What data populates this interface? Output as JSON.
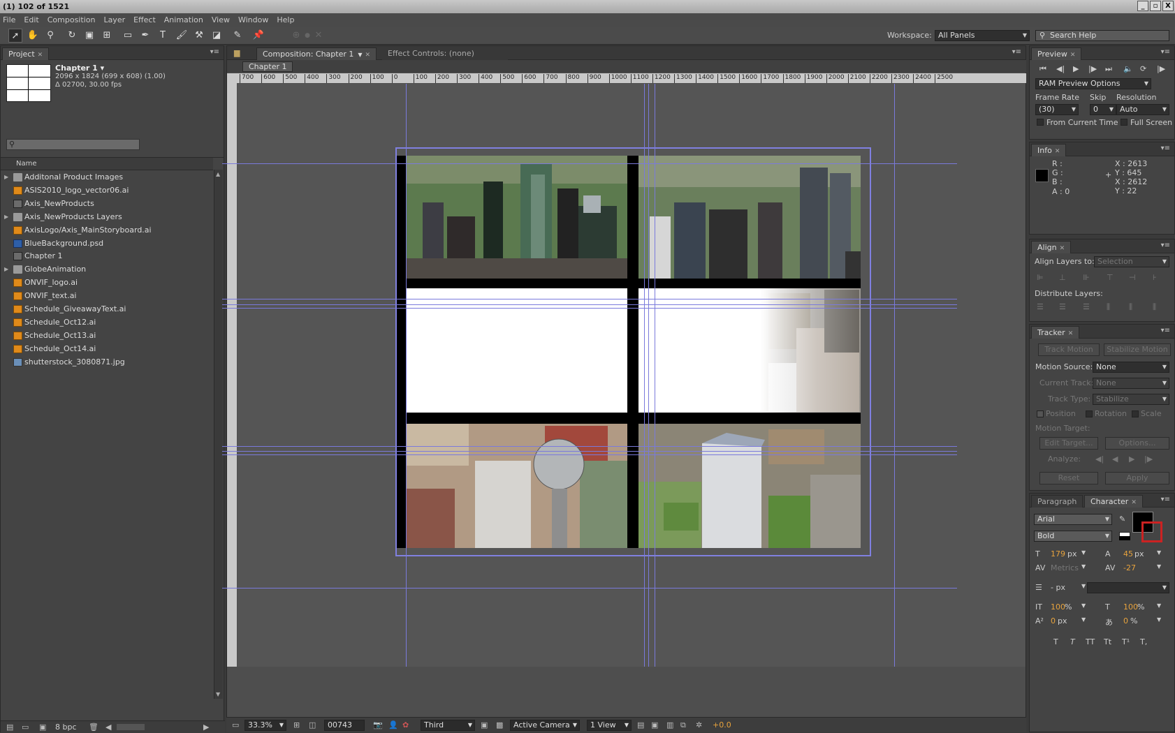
{
  "window": {
    "title": "(1) 102 of 1521",
    "buttons": [
      "_",
      "▫",
      "X"
    ]
  },
  "menu": [
    "File",
    "Edit",
    "Composition",
    "Layer",
    "Effect",
    "Animation",
    "View",
    "Window",
    "Help"
  ],
  "workspace": {
    "label": "Workspace:",
    "value": "All Panels",
    "search_placeholder": "Search Help"
  },
  "project": {
    "tab": "Project",
    "comp_name": "Chapter 1 ▾",
    "comp_info1": "2096 x 1824  (699 x 608) (1.00)",
    "comp_info2": "Δ 02700, 30.00 fps",
    "column_name": "Name",
    "items": [
      {
        "name": "Additonal Product Images",
        "type": "folder"
      },
      {
        "name": "ASIS2010_logo_vector06.ai",
        "type": "ai"
      },
      {
        "name": "Axis_NewProducts",
        "type": "comp"
      },
      {
        "name": "Axis_NewProducts Layers",
        "type": "folder"
      },
      {
        "name": "AxisLogo/Axis_MainStoryboard.ai",
        "type": "ai"
      },
      {
        "name": "BlueBackground.psd",
        "type": "psd"
      },
      {
        "name": "Chapter 1",
        "type": "comp"
      },
      {
        "name": "GlobeAnimation",
        "type": "folder"
      },
      {
        "name": "ONVIF_logo.ai",
        "type": "ai"
      },
      {
        "name": "ONVIF_text.ai",
        "type": "ai"
      },
      {
        "name": "Schedule_GiveawayText.ai",
        "type": "ai"
      },
      {
        "name": "Schedule_Oct12.ai",
        "type": "ai"
      },
      {
        "name": "Schedule_Oct13.ai",
        "type": "ai"
      },
      {
        "name": "Schedule_Oct14.ai",
        "type": "ai"
      },
      {
        "name": "shutterstock_3080871.jpg",
        "type": "jpg"
      }
    ],
    "bpc": "8 bpc"
  },
  "composition": {
    "tab": "Composition: Chapter 1",
    "effect_tab": "Effect Controls: (none)",
    "sub_tab": "Chapter 1",
    "ruler_labels": [
      "700",
      "600",
      "500",
      "400",
      "300",
      "200",
      "100",
      "0",
      "100",
      "200",
      "300",
      "400",
      "500",
      "600",
      "700",
      "800",
      "900",
      "1000",
      "1100",
      "1200",
      "1300",
      "1400",
      "1500",
      "1600",
      "1700",
      "1800",
      "1900",
      "2000",
      "2100",
      "2200",
      "2300",
      "2400",
      "2500"
    ],
    "zoom": "33.3%",
    "timecode": "00743",
    "resolution": "Third",
    "camera": "Active Camera",
    "view": "1 View",
    "exposure": "+0.0"
  },
  "preview": {
    "tab": "Preview",
    "ram": "RAM Preview Options",
    "frame_rate_label": "Frame Rate",
    "skip_label": "Skip",
    "resolution_label": "Resolution",
    "frame_rate": "(30)",
    "skip": "0",
    "resolution": "Auto",
    "from_current": "From Current Time",
    "full_screen": "Full Screen"
  },
  "info": {
    "tab": "Info",
    "r": "R :",
    "g": "G :",
    "b": "B :",
    "a": "A : 0",
    "x1": "X : 2613",
    "y1": "Y : 645",
    "x2": "X : 2612",
    "y2": "Y : 22"
  },
  "align": {
    "tab": "Align",
    "align_to_label": "Align Layers to:",
    "align_to": "Selection",
    "distribute": "Distribute Layers:"
  },
  "tracker": {
    "tab": "Tracker",
    "track_motion": "Track Motion",
    "stabilize_motion": "Stabilize Motion",
    "motion_source_label": "Motion Source:",
    "motion_source": "None",
    "current_track_label": "Current Track:",
    "current_track": "None",
    "track_type_label": "Track Type:",
    "track_type": "Stabilize",
    "position": "Position",
    "rotation": "Rotation",
    "scale": "Scale",
    "motion_target": "Motion Target:",
    "edit_target": "Edit Target...",
    "options": "Options...",
    "analyze": "Analyze:",
    "reset": "Reset",
    "apply": "Apply"
  },
  "character": {
    "tab_paragraph": "Paragraph",
    "tab_character": "Character",
    "font": "Arial",
    "style": "Bold",
    "size": "179",
    "leading": "45",
    "kerning": "Metrics",
    "tracking": "-27",
    "stroke_unit": "- px",
    "vscale": "100",
    "hscale": "100",
    "baseline": "0",
    "tsume": "0",
    "px": "px",
    "pct": "%",
    "styles": [
      "T",
      "T",
      "TT",
      "Tt",
      "T¹",
      "T,"
    ]
  }
}
